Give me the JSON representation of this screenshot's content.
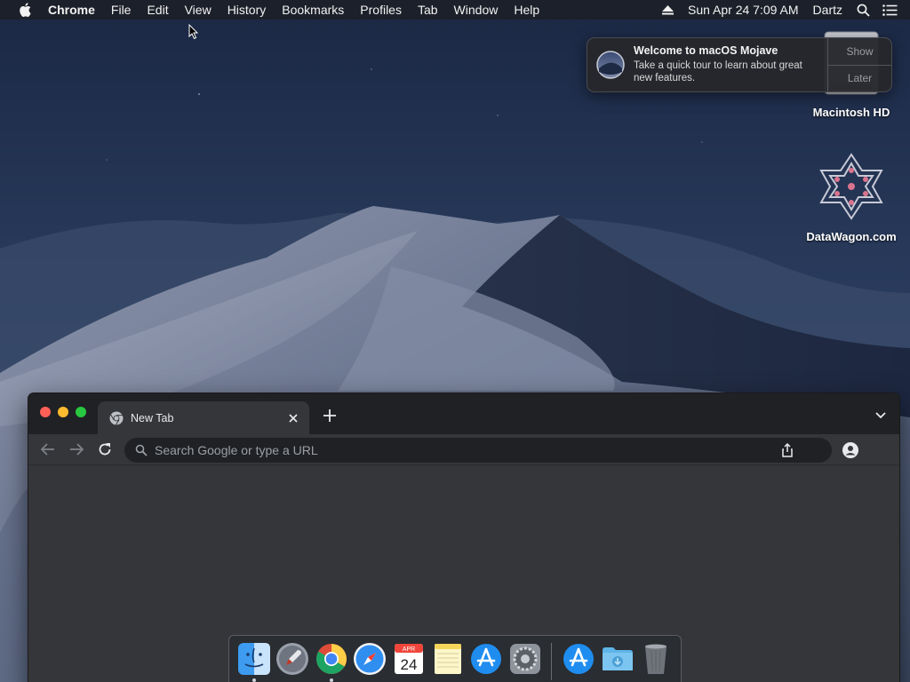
{
  "menubar": {
    "app_name": "Chrome",
    "items": [
      "File",
      "Edit",
      "View",
      "History",
      "Bookmarks",
      "Profiles",
      "Tab",
      "Window",
      "Help"
    ],
    "clock": "Sun Apr 24  7:09 AM",
    "user": "Dartz",
    "icons": [
      "apple-logo-icon",
      "eject-icon",
      "spotlight-search-icon",
      "notification-center-icon"
    ]
  },
  "desktop": {
    "icons": [
      {
        "label": "Macintosh HD",
        "icon": "hard-drive-icon"
      },
      {
        "label": "DataWagon.com",
        "icon": "datawagon-logo-icon"
      }
    ]
  },
  "notification": {
    "title": "Welcome to macOS Mojave",
    "text": "Take a quick tour to learn about great new features.",
    "show_label": "Show",
    "later_label": "Later",
    "icon": "mojave-icon"
  },
  "chrome": {
    "tab_title": "New Tab",
    "omnibox_placeholder": "Search Google or type a URL",
    "icons": [
      "chrome-favicon-icon",
      "close-icon",
      "plus-icon",
      "chevron-down-icon",
      "back-arrow-icon",
      "forward-arrow-icon",
      "reload-icon",
      "search-icon",
      "share-icon",
      "profile-icon"
    ]
  },
  "dock": {
    "apps": [
      {
        "name": "Finder",
        "icon": "finder-icon",
        "running": true
      },
      {
        "name": "Launchpad",
        "icon": "launchpad-icon",
        "running": false
      },
      {
        "name": "Google Chrome",
        "icon": "chrome-icon",
        "running": true
      },
      {
        "name": "Safari",
        "icon": "safari-icon",
        "running": false
      },
      {
        "name": "Calendar",
        "icon": "calendar-icon",
        "running": false,
        "month": "APR",
        "day": "24"
      },
      {
        "name": "Notes",
        "icon": "notes-icon",
        "running": false
      },
      {
        "name": "App Store",
        "icon": "app-store-icon",
        "running": false
      },
      {
        "name": "System Preferences",
        "icon": "system-preferences-icon",
        "running": false
      }
    ],
    "others": [
      {
        "name": "App Store",
        "icon": "app-store-icon"
      },
      {
        "name": "Downloads",
        "icon": "downloads-folder-icon"
      },
      {
        "name": "Trash",
        "icon": "trash-icon"
      }
    ]
  },
  "colors": {
    "menubar_bg": "#1c1f28",
    "chrome_frame": "#202124",
    "chrome_toolbar": "#35363a",
    "traffic_close": "#fe5f57",
    "traffic_min": "#febc2e",
    "traffic_max": "#28c840"
  }
}
